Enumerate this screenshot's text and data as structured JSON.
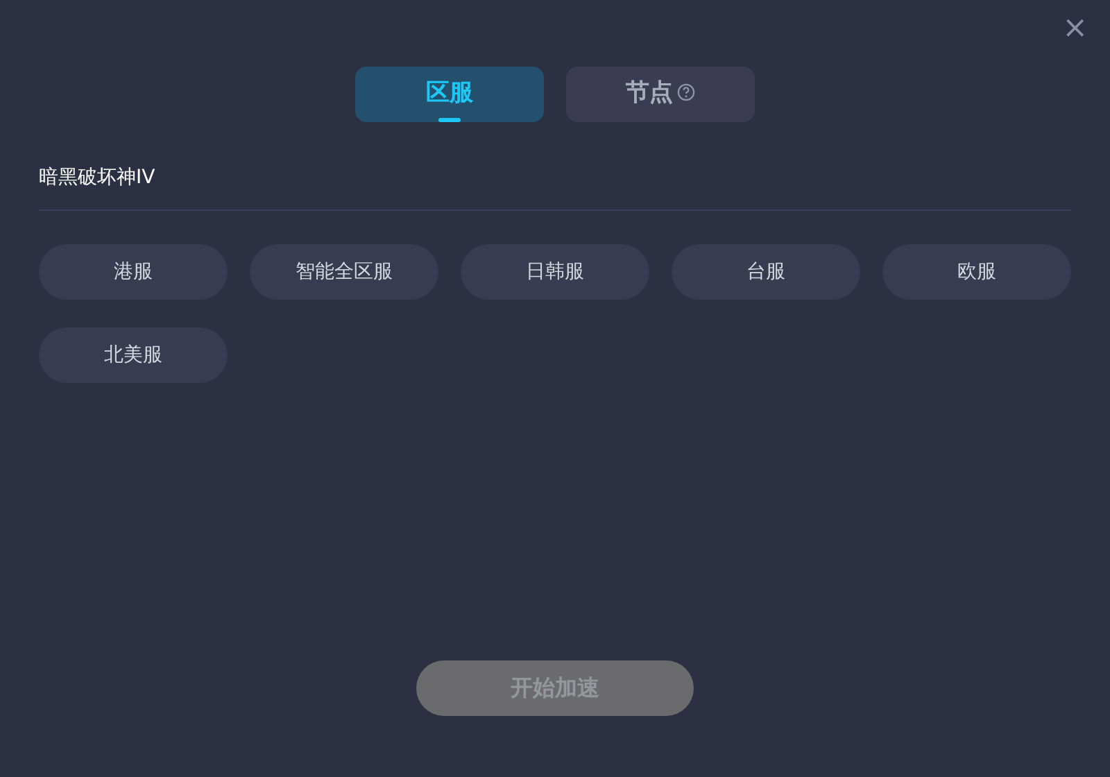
{
  "close_button": "×",
  "tabs": [
    {
      "label": "区服",
      "selected": true,
      "help": false
    },
    {
      "label": "节点",
      "selected": false,
      "help": true
    }
  ],
  "game_title": "暗黑破坏神IV",
  "servers": [
    {
      "label": "港服",
      "selected": false
    },
    {
      "label": "智能全区服",
      "selected": false
    },
    {
      "label": "日韩服",
      "selected": false
    },
    {
      "label": "台服",
      "selected": false
    },
    {
      "label": "欧服",
      "selected": false
    },
    {
      "label": "北美服",
      "selected": false
    }
  ],
  "start_button": {
    "label": "开始加速",
    "disabled": true
  }
}
